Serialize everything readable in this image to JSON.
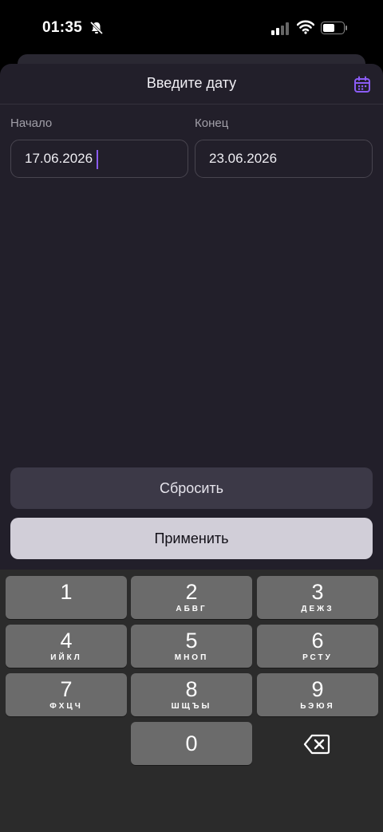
{
  "status_bar": {
    "time": "01:35",
    "icons": [
      "bell-slash-icon",
      "cellular-signal-icon",
      "wifi-icon",
      "battery-icon"
    ]
  },
  "sheet": {
    "title": "Введите дату",
    "calendar_icon": "calendar-icon",
    "accent_color": "#8b5cf6",
    "start": {
      "label": "Начало",
      "value": "17.06.2026"
    },
    "end": {
      "label": "Конец",
      "value": "23.06.2026"
    },
    "reset_label": "Сбросить",
    "apply_label": "Применить"
  },
  "keypad": {
    "keys": [
      {
        "digit": "1",
        "letters": ""
      },
      {
        "digit": "2",
        "letters": "АБВГ"
      },
      {
        "digit": "3",
        "letters": "ДЕЖЗ"
      },
      {
        "digit": "4",
        "letters": "ИЙКЛ"
      },
      {
        "digit": "5",
        "letters": "МНОП"
      },
      {
        "digit": "6",
        "letters": "РСТУ"
      },
      {
        "digit": "7",
        "letters": "ФХЦЧ"
      },
      {
        "digit": "8",
        "letters": "ШЩЪЫ"
      },
      {
        "digit": "9",
        "letters": "ЬЭЮЯ"
      },
      {
        "digit": "0",
        "letters": ""
      }
    ],
    "delete_icon": "backspace-icon"
  }
}
